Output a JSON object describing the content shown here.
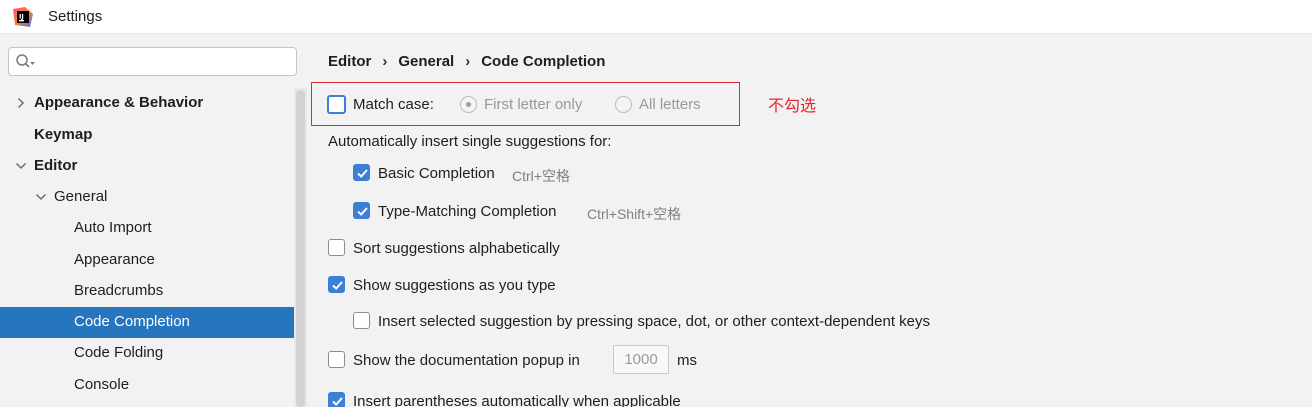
{
  "window": {
    "title": "Settings"
  },
  "colors": {
    "accent": "#2675bf",
    "annotation": "#e0282e",
    "checkbox": "#3c7fd6"
  },
  "sidebar": {
    "search": {
      "placeholder": "",
      "value": ""
    },
    "items": [
      {
        "label": "Appearance & Behavior",
        "expanded": false
      },
      {
        "label": "Keymap"
      },
      {
        "label": "Editor",
        "expanded": true
      },
      {
        "label": "General",
        "expanded": true
      },
      {
        "label": "Auto Import"
      },
      {
        "label": "Appearance"
      },
      {
        "label": "Breadcrumbs"
      },
      {
        "label": "Code Completion",
        "selected": true
      },
      {
        "label": "Code Folding"
      },
      {
        "label": "Console"
      }
    ]
  },
  "breadcrumb": [
    "Editor",
    "General",
    "Code Completion"
  ],
  "annotation": "不勾选",
  "match_case": {
    "label": "Match case:",
    "checked": false,
    "options": [
      {
        "label": "First letter only",
        "selected": true
      },
      {
        "label": "All letters",
        "selected": false
      }
    ]
  },
  "auto_insert": {
    "label": "Automatically insert single suggestions for:",
    "basic": {
      "label": "Basic Completion",
      "shortcut": "Ctrl+空格",
      "checked": true
    },
    "type_matching": {
      "label": "Type-Matching Completion",
      "shortcut": "Ctrl+Shift+空格",
      "checked": true
    }
  },
  "options": {
    "sort_alpha": {
      "label": "Sort suggestions alphabetically",
      "checked": false
    },
    "show_as_type": {
      "label": "Show suggestions as you type",
      "checked": true
    },
    "insert_selected": {
      "label": "Insert selected suggestion by pressing space, dot, or other context-dependent keys",
      "checked": false
    },
    "doc_popup": {
      "label": "Show the documentation popup in",
      "value": "1000",
      "unit": "ms",
      "checked": false
    },
    "insert_parens": {
      "label": "Insert parentheses automatically when applicable",
      "checked": true
    }
  }
}
